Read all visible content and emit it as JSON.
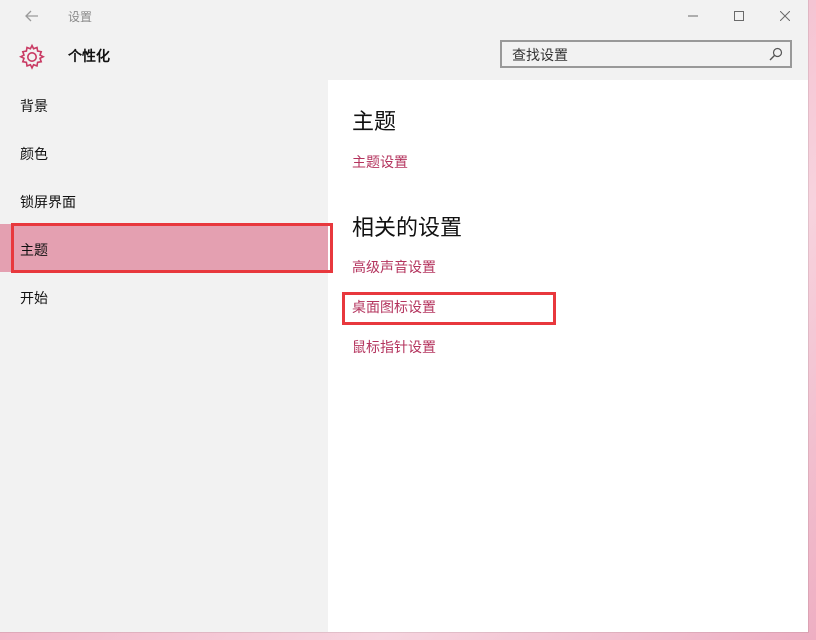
{
  "window": {
    "app_title": "设置",
    "back_icon": "arrow-left-icon",
    "controls": {
      "minimize_icon": "minimize-icon",
      "maximize_icon": "maximize-icon",
      "close_icon": "close-icon"
    }
  },
  "header": {
    "icon": "gear-icon",
    "title": "个性化",
    "search": {
      "placeholder": "查找设置",
      "value": "",
      "icon": "search-icon"
    }
  },
  "sidebar": {
    "items": [
      {
        "label": "背景",
        "selected": false
      },
      {
        "label": "颜色",
        "selected": false
      },
      {
        "label": "锁屏界面",
        "selected": false
      },
      {
        "label": "主题",
        "selected": true
      },
      {
        "label": "开始",
        "selected": false
      }
    ]
  },
  "content": {
    "section1": {
      "heading": "主题",
      "links": [
        "主题设置"
      ]
    },
    "section2": {
      "heading": "相关的设置",
      "links": [
        "高级声音设置",
        "桌面图标设置",
        "鼠标指针设置"
      ]
    }
  },
  "colors": {
    "accent": "#b4345e",
    "selected_bg": "#e4a0b1",
    "highlight_outline": "#e8383d",
    "sidebar_bg": "#f2f2f2"
  }
}
